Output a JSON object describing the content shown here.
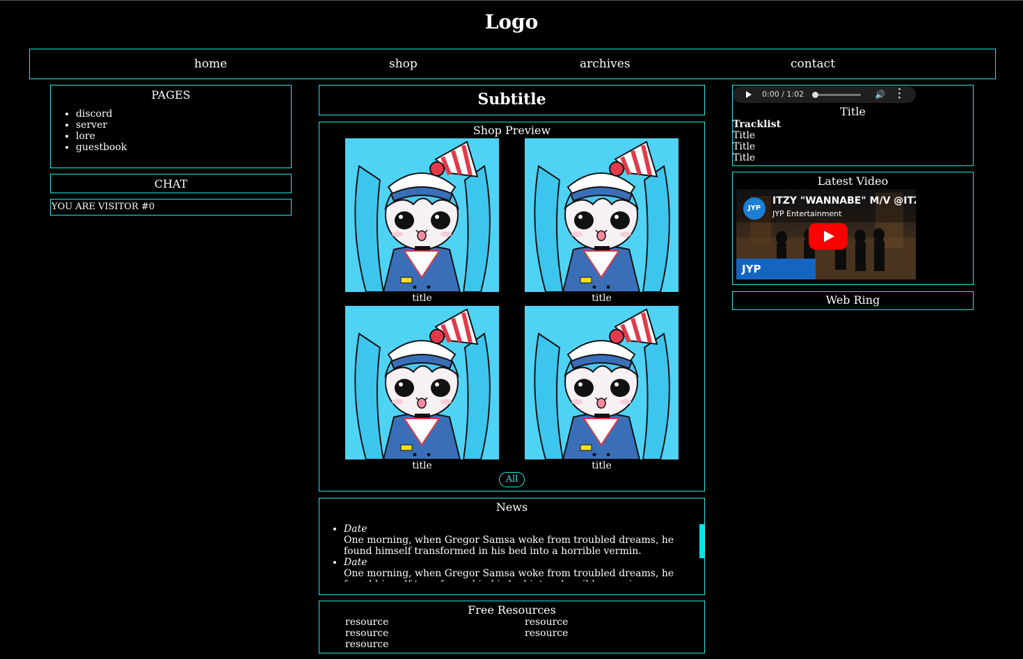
{
  "logo": "Logo",
  "nav": {
    "items": [
      "home",
      "shop",
      "archives",
      "contact"
    ]
  },
  "left": {
    "pages_title": "PAGES",
    "pages": [
      "discord",
      "server",
      "lore",
      "guestbook"
    ],
    "chat_title": "CHAT",
    "visitor": "YOU ARE VISITOR #0"
  },
  "center": {
    "subtitle": "Subtitle",
    "shop_title": "Shop Preview",
    "products": [
      "title",
      "title",
      "title",
      "title"
    ],
    "all_button": "All",
    "news_title": "News",
    "news": [
      {
        "date": "Date",
        "text": "One morning, when Gregor Samsa woke from troubled dreams, he found himself transformed in his bed into a horrible vermin."
      },
      {
        "date": "Date",
        "text": "One morning, when Gregor Samsa woke from troubled dreams, he found himself transformed in his bed into a horrible vermin."
      }
    ],
    "resources_title": "Free Resources",
    "resources": [
      "resource",
      "resource",
      "resource",
      "resource",
      "resource"
    ]
  },
  "right": {
    "audio_time": "0:00 / 1:02",
    "music_title": "Title",
    "tracklist_label": "Tracklist",
    "tracks": [
      "Title",
      "Title",
      "Title"
    ],
    "latest_video_title": "Latest Video",
    "video_title": "ITZY \"WANNABE\" M/V @ITZ",
    "video_channel": "JYP Entertainment",
    "video_badge": "JYP OFFICIAL",
    "channel_logo": "JYP",
    "webring_title": "Web Ring"
  },
  "colors": {
    "accent": "#2ee6e6",
    "background": "#000000",
    "text": "#ffffff",
    "youtube": "#ff0000"
  }
}
